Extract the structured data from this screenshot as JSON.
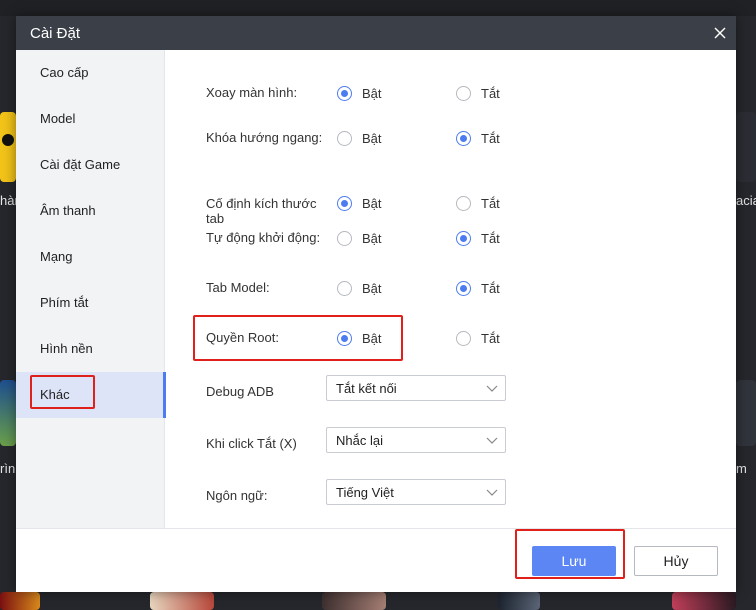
{
  "dialog": {
    "title": "Cài Đặt",
    "close_icon": "close-icon"
  },
  "sidebar": {
    "items": [
      {
        "label": "Cao cấp"
      },
      {
        "label": "Model"
      },
      {
        "label": "Cài đặt Game"
      },
      {
        "label": "Âm thanh"
      },
      {
        "label": "Mạng"
      },
      {
        "label": "Phím tắt"
      },
      {
        "label": "Hình nền"
      },
      {
        "label": "Khác",
        "active": true
      }
    ]
  },
  "options": {
    "on_label": "Bật",
    "off_label": "Tắt",
    "rows": [
      {
        "label": "Xoay màn hình:",
        "selected": "on"
      },
      {
        "label": "Khóa hướng ngang:",
        "selected": "off"
      },
      {
        "label": "Cố định kích thước tab",
        "selected": "on"
      },
      {
        "label": "Tự động khởi động:",
        "selected": "off"
      },
      {
        "label": "Tab Model:",
        "selected": "off"
      },
      {
        "label": "Quyền Root:",
        "selected": "on"
      }
    ]
  },
  "selects": [
    {
      "label": "Debug ADB",
      "value": "Tắt kết nối"
    },
    {
      "label": "Khi click Tắt (X)",
      "value": "Nhắc lại"
    },
    {
      "label": "Ngôn ngữ:",
      "value": "Tiếng Việt"
    }
  ],
  "footer": {
    "save_label": "Lưu",
    "cancel_label": "Hủy"
  },
  "background": {
    "left_labels": [
      "hàn",
      "rìn"
    ],
    "right_labels": [
      "acia",
      "m"
    ]
  },
  "colors": {
    "accent": "#4d7cf0",
    "titlebar": "#3b3f47",
    "highlight": "#e0201b",
    "save_button": "#5b86f3"
  }
}
